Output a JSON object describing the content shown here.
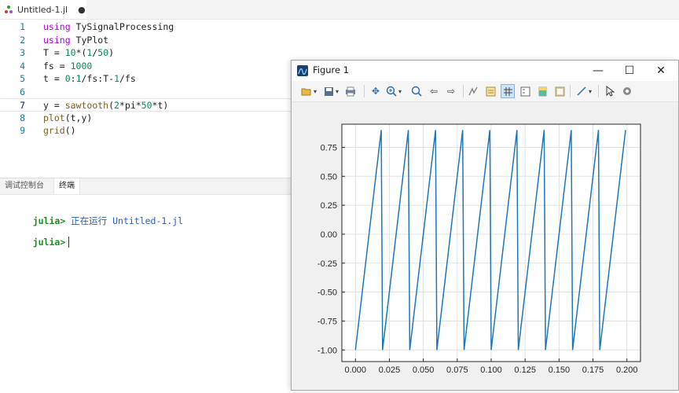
{
  "editor_tab": {
    "filename": "Untitled-1.jl",
    "dirty_marker": "●"
  },
  "code": {
    "lines": [
      {
        "n": "1",
        "tokens": [
          [
            "kw",
            "using"
          ],
          [
            "t",
            " TySignalProcessing"
          ]
        ]
      },
      {
        "n": "2",
        "tokens": [
          [
            "kw",
            "using"
          ],
          [
            "t",
            " TyPlot"
          ]
        ]
      },
      {
        "n": "3",
        "tokens": [
          [
            "t",
            "T = "
          ],
          [
            "num",
            "10"
          ],
          [
            "t",
            "*("
          ],
          [
            "num",
            "1"
          ],
          [
            "t",
            "/"
          ],
          [
            "num",
            "50"
          ],
          [
            "t",
            ")"
          ]
        ]
      },
      {
        "n": "4",
        "tokens": [
          [
            "t",
            "fs = "
          ],
          [
            "num",
            "1000"
          ]
        ]
      },
      {
        "n": "5",
        "tokens": [
          [
            "t",
            "t = "
          ],
          [
            "num",
            "0"
          ],
          [
            "t",
            ":"
          ],
          [
            "num",
            "1"
          ],
          [
            "t",
            "/fs:T-"
          ],
          [
            "num",
            "1"
          ],
          [
            "t",
            "/fs"
          ]
        ]
      },
      {
        "n": "6",
        "tokens": []
      },
      {
        "n": "7",
        "tokens": [
          [
            "t",
            "y = "
          ],
          [
            "fn",
            "sawtooth"
          ],
          [
            "t",
            "("
          ],
          [
            "num",
            "2"
          ],
          [
            "t",
            "*pi*"
          ],
          [
            "num",
            "50"
          ],
          [
            "t",
            "*t)"
          ]
        ]
      },
      {
        "n": "8",
        "tokens": [
          [
            "fn",
            "plot"
          ],
          [
            "t",
            "(t,y)"
          ]
        ]
      },
      {
        "n": "9",
        "tokens": [
          [
            "fn",
            "grid"
          ],
          [
            "t",
            "()"
          ]
        ]
      }
    ],
    "current_line": "7"
  },
  "panel": {
    "tabs": [
      "调试控制台",
      "终端"
    ],
    "active_tab": "终端",
    "terminal": [
      {
        "prompt": "julia>",
        "text": " 正在运行 Untitled-1.jl"
      },
      {
        "prompt": "julia>",
        "text": ""
      }
    ]
  },
  "figure": {
    "title": "Figure 1",
    "window_buttons": {
      "minimize": "—",
      "maximize": "☐",
      "close": "✕"
    },
    "toolbar_icons": [
      "open-icon",
      "save-icon",
      "print-icon",
      "pan-icon",
      "zoom-in-icon",
      "zoom-fit-icon",
      "back-icon",
      "forward-icon",
      "brush-icon",
      "data-tip-icon",
      "grid-icon",
      "legend-icon",
      "colorbar-icon",
      "frame-icon",
      "line-icon",
      "pointer-icon",
      "settings-icon"
    ],
    "line_color": "#1f77b4"
  },
  "chart_data": {
    "type": "line",
    "title": "",
    "xlabel": "",
    "ylabel": "",
    "xlim": [
      -0.01,
      0.21
    ],
    "ylim": [
      -1.1,
      0.95
    ],
    "grid": true,
    "xticks": [
      0.0,
      0.025,
      0.05,
      0.075,
      0.1,
      0.125,
      0.15,
      0.175,
      0.2
    ],
    "xtick_labels": [
      "0.000",
      "0.025",
      "0.050",
      "0.075",
      "0.100",
      "0.125",
      "0.150",
      "0.175",
      "0.200"
    ],
    "yticks": [
      -1.0,
      -0.75,
      -0.5,
      -0.25,
      0.0,
      0.25,
      0.5,
      0.75
    ],
    "ytick_labels": [
      "-1.00",
      "-0.75",
      "-0.50",
      "-0.25",
      "0.00",
      "0.25",
      "0.50",
      "0.75"
    ],
    "series": [
      {
        "x": [
          0.0,
          0.019,
          0.02,
          0.039,
          0.04,
          0.059,
          0.06,
          0.079,
          0.08,
          0.099,
          0.1,
          0.119,
          0.12,
          0.139,
          0.14,
          0.159,
          0.16,
          0.179,
          0.18,
          0.199
        ],
        "y": [
          -1.0,
          0.9,
          -1.0,
          0.9,
          -1.0,
          0.9,
          -1.0,
          0.9,
          -1.0,
          0.9,
          -1.0,
          0.9,
          -1.0,
          0.9,
          -1.0,
          0.9,
          -1.0,
          0.9,
          -1.0,
          0.9
        ]
      }
    ]
  }
}
